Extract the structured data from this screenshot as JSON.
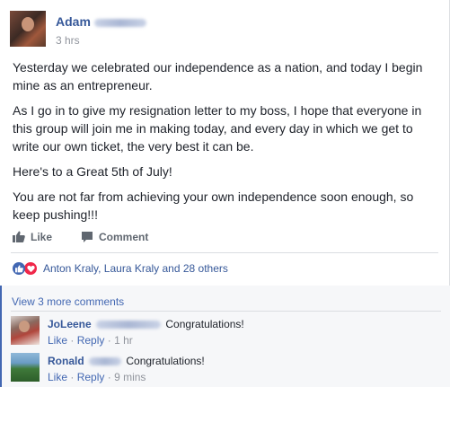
{
  "post": {
    "author_first": "Adam",
    "time": "3 hrs",
    "paragraphs": [
      "Yesterday we celebrated our independence as a nation, and today I begin mine as an entrepreneur.",
      "As I go in to give my resignation letter to my boss, I hope that everyone in this group will join me in making today, and every day in which we get to write our own ticket, the very best it can be.",
      "Here's to a Great 5th of July!",
      "You are not far from achieving your own independence soon enough, so keep pushing!!!"
    ]
  },
  "actions": {
    "like_label": "Like",
    "comment_label": "Comment"
  },
  "reactions": {
    "names": "Anton Kraly, Laura Kraly and 28 others",
    "types": [
      "like",
      "love"
    ],
    "colors": {
      "like": "#4267b2",
      "love": "#f0284a"
    }
  },
  "comments": {
    "view_more": "View 3 more comments",
    "items": [
      {
        "name": "JoLeene",
        "text": "Congratulations!",
        "like": "Like",
        "reply": "Reply",
        "time": "1 hr"
      },
      {
        "name": "Ronald",
        "text": "Congratulations!",
        "like": "Like",
        "reply": "Reply",
        "time": "9 mins"
      }
    ]
  },
  "colors": {
    "link": "#365899",
    "accent": "#4267b2",
    "text": "#1d2129",
    "muted": "#90949c"
  }
}
